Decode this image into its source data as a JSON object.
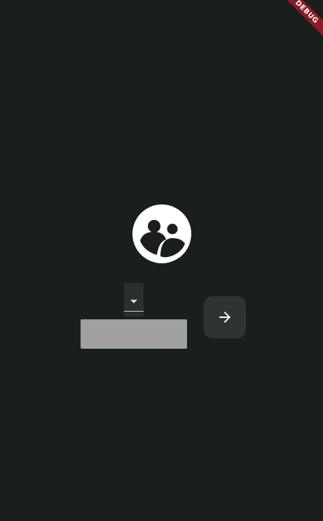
{
  "debug_banner": {
    "label": "DEBUG",
    "color": "#8b1a24"
  },
  "logo": {
    "icon": "group-people-icon"
  },
  "dropdown": {
    "selected_value": "",
    "icon": "arrow-drop-down-icon"
  },
  "text_field": {
    "value": "",
    "placeholder": ""
  },
  "submit_button": {
    "icon": "arrow-forward-icon"
  },
  "colors": {
    "background": "#1a1e1f",
    "field_fill": "#a0a0a0",
    "button_fill": "#2f3334",
    "icon": "#ffffff"
  }
}
